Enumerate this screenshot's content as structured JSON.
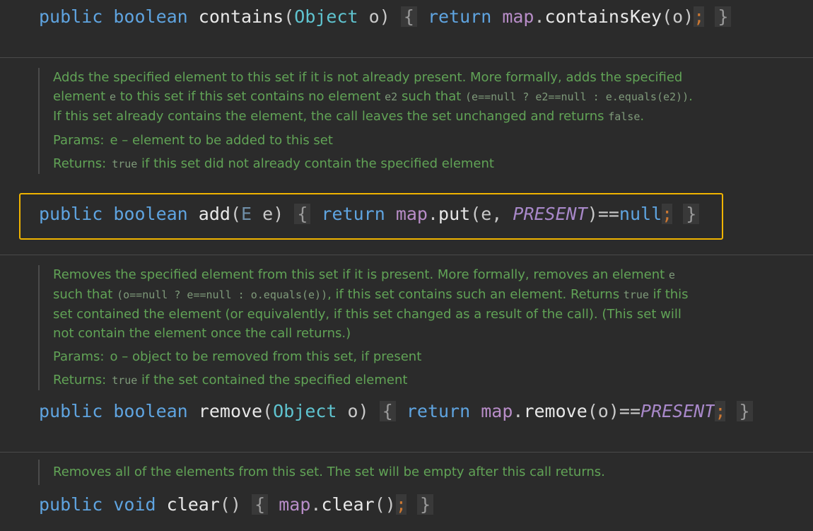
{
  "code": {
    "contains": {
      "mod": "public",
      "ret": "boolean",
      "name": "contains",
      "open": "(",
      "argType": "Object",
      "argName": " o",
      "close": ")",
      "lbrace": "{",
      "return": "return",
      "recv": "map",
      "dot": ".",
      "call": "containsKey",
      "args": "(o)",
      "semi": ";",
      "rbrace": "}"
    },
    "add": {
      "mod": "public",
      "ret": "boolean",
      "name": "add",
      "open": "(",
      "argType": "E",
      "argName": " e",
      "close": ")",
      "lbrace": "{",
      "return": "return",
      "recv": "map",
      "dot": ".",
      "call": "put",
      "args1": "(e, ",
      "konst": "PRESENT",
      "args2": ")==",
      "null": "null",
      "semi": ";",
      "rbrace": "}"
    },
    "remove": {
      "mod": "public",
      "ret": "boolean",
      "name": "remove",
      "open": "(",
      "argType": "Object",
      "argName": " o",
      "close": ")",
      "lbrace": "{",
      "return": "return",
      "recv": "map",
      "dot": ".",
      "call": "remove",
      "args1": "(o)==",
      "konst": "PRESENT",
      "semi": ";",
      "rbrace": "}"
    },
    "clear": {
      "mod": "public",
      "ret": "void",
      "name": "clear",
      "parens": "()",
      "lbrace": "{",
      "recv": "map",
      "dot": ".",
      "call": "clear",
      "args": "()",
      "semi": ";",
      "rbrace": "}"
    }
  },
  "docs": {
    "add": {
      "t1": "Adds the specified element to this set if it is not already present. More formally, adds the specified element ",
      "c1": "e",
      "t2": " to this set if this set contains no element ",
      "c2": "e2",
      "t3": " such that ",
      "c3": "(e==null ? e2==null : e.equals(e2))",
      "t4": ". If this set already contains the element, the call leaves the set unchanged and returns ",
      "c4": "false",
      "t5": ".",
      "params_label": "Params:",
      "params_text": "e – element to be added to this set",
      "returns_label": "Returns:",
      "returns_code": "true",
      "returns_text": " if this set did not already contain the specified element"
    },
    "remove": {
      "t1": "Removes the specified element from this set if it is present. More formally, removes an element ",
      "c1": "e",
      "t2": " such that ",
      "c2": "(o==null ? e==null : o.equals(e))",
      "t3": ", if this set contains such an element. Returns ",
      "c3": "true",
      "t4": " if this set contained the element (or equivalently, if this set changed as a result of the call). (This set will not contain the element once the call returns.)",
      "params_label": "Params:",
      "params_text": "o – object to be removed from this set, if present",
      "returns_label": "Returns:",
      "returns_code": "true",
      "returns_text": " if the set contained the specified element"
    },
    "clear": {
      "text": "Removes all of the elements from this set. The set will be empty after this call returns."
    }
  }
}
